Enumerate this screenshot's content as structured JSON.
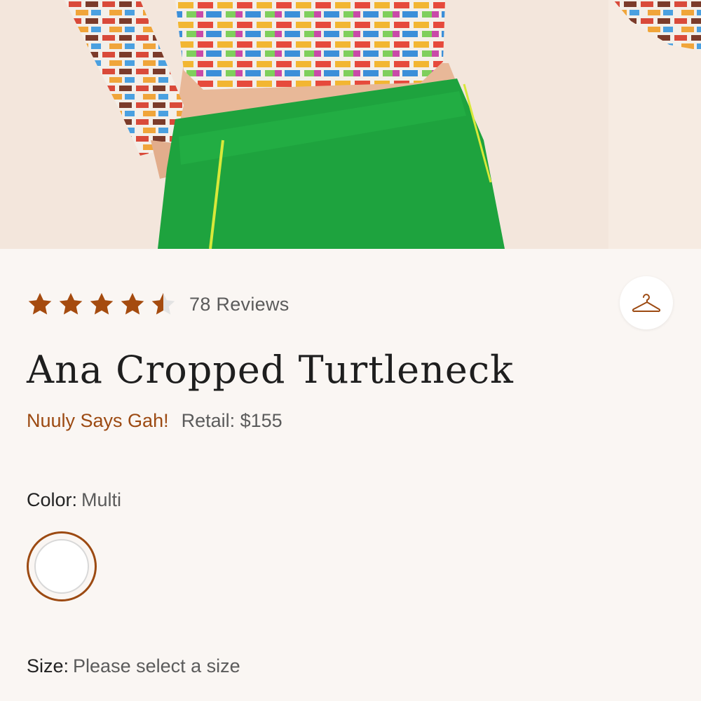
{
  "product": {
    "image_alt": "Model wearing multicolor checkered cropped top with green pants",
    "rating": 4.5,
    "reviews_label": "78 Reviews",
    "title": "Ana Cropped Turtleneck",
    "badge": "Nuuly Says Gah!",
    "retail": "Retail: $155"
  },
  "color": {
    "label": "Color:",
    "value": "Multi"
  },
  "size": {
    "label": "Size:",
    "value": "Please select a size"
  },
  "colors": {
    "accent": "#9c4a12",
    "star": "#a54b0f",
    "star_empty": "#e3e3e3",
    "pants": "#1ea33e",
    "background": "#faf6f3"
  },
  "icons": {
    "closet": "hanger-icon",
    "star": "star-icon"
  }
}
